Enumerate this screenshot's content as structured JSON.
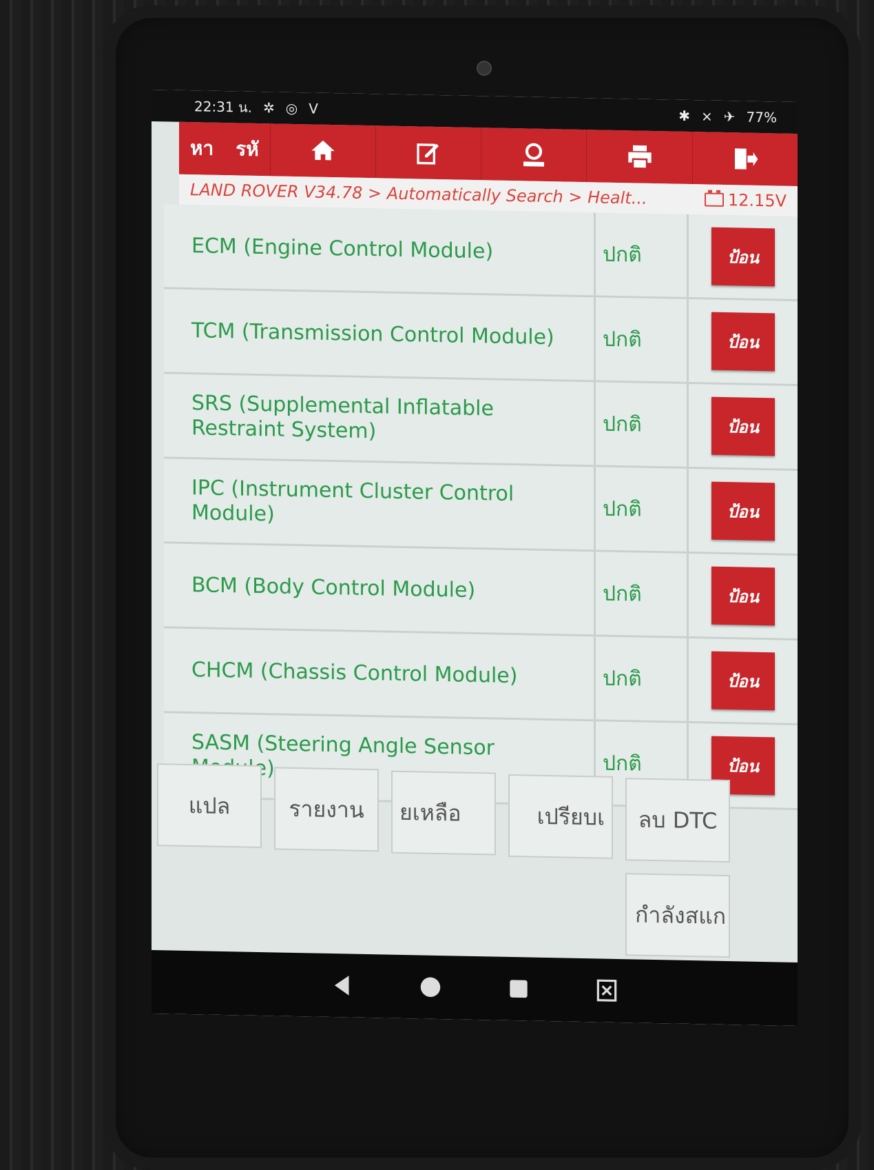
{
  "status_bar": {
    "time": "22:31 น.",
    "battery": "77%"
  },
  "toolbar": {
    "search_label": "หา",
    "code_label": "รหั",
    "icons": [
      "home-icon",
      "edit-icon",
      "user-icon",
      "print-icon",
      "exit-icon"
    ]
  },
  "breadcrumb": {
    "path": "LAND ROVER V34.78 > Automatically Search > Healt...",
    "voltage": "12.15V"
  },
  "modules": [
    {
      "name": "ECM (Engine Control Module)",
      "status": "ปกติ",
      "action": "ป้อน"
    },
    {
      "name": "TCM (Transmission Control Module)",
      "status": "ปกติ",
      "action": "ป้อน"
    },
    {
      "name": "SRS (Supplemental Inflatable Restraint System)",
      "status": "ปกติ",
      "action": "ป้อน"
    },
    {
      "name": "IPC (Instrument Cluster Control Module)",
      "status": "ปกติ",
      "action": "ป้อน"
    },
    {
      "name": "BCM (Body Control Module)",
      "status": "ปกติ",
      "action": "ป้อน"
    },
    {
      "name": "CHCM (Chassis Control Module)",
      "status": "ปกติ",
      "action": "ป้อน"
    },
    {
      "name": "SASM (Steering Angle Sensor Module)",
      "status": "ปกติ",
      "action": "ป้อน"
    }
  ],
  "bottom_buttons": {
    "translate": "แปล",
    "report": "รายงาน",
    "remaining": "ยเหลือ",
    "compare": "เปรียบเ",
    "clear_dtc": "ลบ DTC",
    "scanning": "กำลังสแก"
  },
  "colors": {
    "accent_red": "#c8262b",
    "ok_green": "#2b9a4a",
    "breadcrumb_red": "#d8453c"
  }
}
